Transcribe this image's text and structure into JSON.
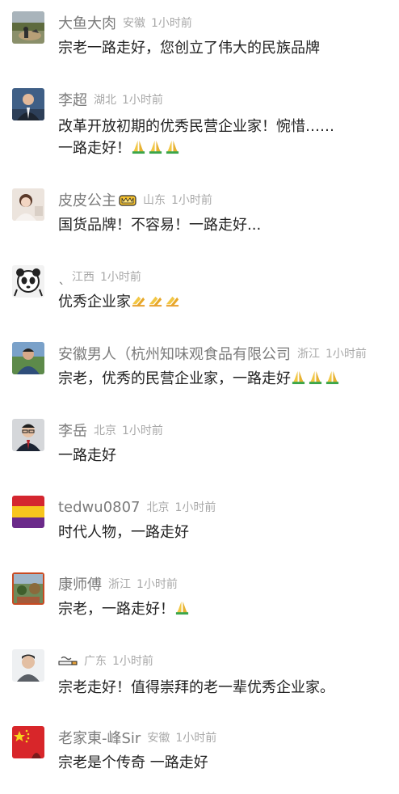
{
  "comments": [
    {
      "name": "大鱼大肉",
      "region": "安徽",
      "time": "1小时前",
      "text": "宗老一路走好，您创立了伟大的民族品牌",
      "avatar_icon": "field-photo-avatar-icon",
      "emoji": "",
      "badge": ""
    },
    {
      "name": "李超",
      "region": "湖北",
      "time": "1小时前",
      "text": "改革开放初期的优秀民营企业家！惋惜……\n一路走好！",
      "avatar_icon": "suit-man-avatar-icon",
      "emoji": "praying-hands-icon",
      "badge": ""
    },
    {
      "name": "皮皮公主",
      "region": "山东",
      "time": "1小时前",
      "text": "国货品牌！不容易！一路走好...",
      "avatar_icon": "girl-avatar-icon",
      "emoji": "",
      "badge": "crown-badge-icon"
    },
    {
      "name": "ˎ",
      "region": "江西",
      "time": "1小时前",
      "text": "优秀企业家",
      "avatar_icon": "panda-sketch-avatar-icon",
      "emoji": "praying-hands-icon",
      "badge": ""
    },
    {
      "name": "安徽男人（杭州知味观食品有限公司",
      "region": "浙江",
      "time": "1小时前",
      "text": "宗老，优秀的民营企业家，一路走好",
      "avatar_icon": "man-outdoor-avatar-icon",
      "emoji": "praying-hands-icon",
      "badge": ""
    },
    {
      "name": "李岳",
      "region": "北京",
      "time": "1小时前",
      "text": "一路走好",
      "avatar_icon": "glasses-man-avatar-icon",
      "emoji": "",
      "badge": ""
    },
    {
      "name": "tedwu0807",
      "region": "北京",
      "time": "1小时前",
      "text": "时代人物，一路走好",
      "avatar_icon": "tricolor-flag-avatar-icon",
      "emoji": "",
      "badge": ""
    },
    {
      "name": "康师傅",
      "region": "浙江",
      "time": "1小时前",
      "text": "宗老，一路走好！",
      "avatar_icon": "garden-photo-avatar-icon",
      "emoji": "praying-hands-icon",
      "badge": ""
    },
    {
      "name": "",
      "region": "广东",
      "time": "1小时前",
      "text": "宗老走好！值得崇拜的老一辈优秀企业家。",
      "avatar_icon": "profile-man-avatar-icon",
      "emoji": "",
      "badge": "cigarette-icon"
    },
    {
      "name": "老家東-峰Sir",
      "region": "安徽",
      "time": "1小时前",
      "text": "宗老是个传奇 一路走好",
      "avatar_icon": "red-flag-avatar-icon",
      "emoji": "",
      "badge": ""
    }
  ],
  "colors": {
    "name": "#7b7b7b",
    "meta": "#a8a8a8",
    "text": "#222222",
    "background": "#ffffff"
  }
}
